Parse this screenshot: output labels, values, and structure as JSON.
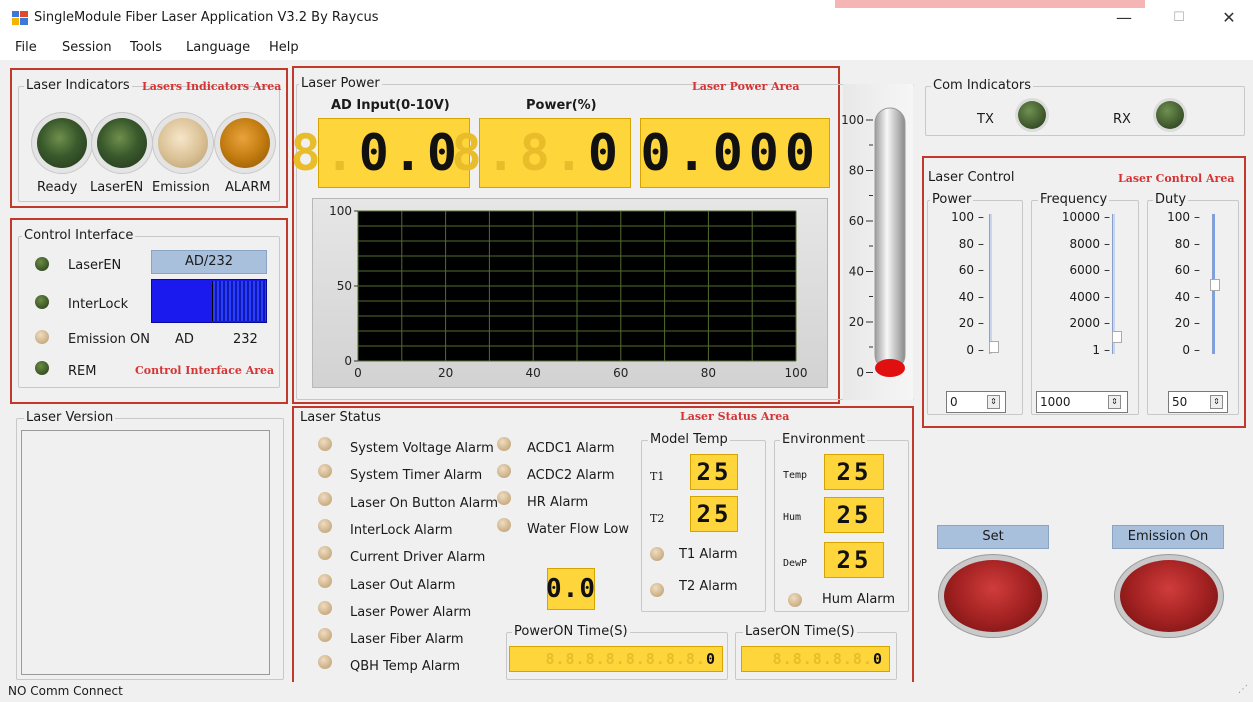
{
  "window": {
    "title": "SingleModule Fiber Laser Application V3.2  By Raycus",
    "minimize": "—",
    "maximize": "☐",
    "close": "✕"
  },
  "menu": [
    "File",
    "Session",
    "Tools",
    "Language",
    "Help"
  ],
  "laser_indicators": {
    "group_label": "Laser Indicators",
    "area_label": "Lasers Indicators Area",
    "leds": [
      {
        "label": "Ready",
        "color": "#3a5a2c"
      },
      {
        "label": "LaserEN",
        "color": "#3a5a2c"
      },
      {
        "label": "Emission",
        "color": "#dcc398"
      },
      {
        "label": "ALARM",
        "color": "#c27c10"
      }
    ]
  },
  "control_interface": {
    "group_label": "Control Interface",
    "area_label": "Control Interface Area",
    "items": [
      "LaserEN",
      "InterLock",
      "Emission ON",
      "REM"
    ],
    "mode_button": "AD/232",
    "switch_left": "AD",
    "switch_right": "232"
  },
  "laser_version": {
    "group_label": "Laser Version"
  },
  "laser_power": {
    "group_label": "Laser Power",
    "area_label": "Laser Power Area",
    "ad_label": "AD Input(0-10V)",
    "power_label": "Power(%)",
    "ad_ghost": "8.",
    "ad_value": "0.0",
    "power_ghost": "8.8.",
    "power_value": "0",
    "third_value": "0.000",
    "graph_y_ticks": [
      "100",
      "50",
      "0"
    ],
    "graph_x_ticks": [
      "0",
      "20",
      "40",
      "60",
      "80",
      "100"
    ],
    "thermo_ticks": [
      "100",
      "80",
      "60",
      "40",
      "20",
      "0"
    ]
  },
  "com_indicators": {
    "group_label": "Com Indicators",
    "tx": "TX",
    "rx": "RX"
  },
  "laser_control": {
    "group_label": "Laser Control",
    "area_label": "Laser Control Area",
    "power": {
      "label": "Power",
      "ticks": [
        "100",
        "80",
        "60",
        "40",
        "20",
        "0"
      ],
      "value": "0"
    },
    "frequency": {
      "label": "Frequency",
      "ticks": [
        "10000",
        "8000",
        "6000",
        "4000",
        "2000",
        "1"
      ],
      "value": "1000"
    },
    "duty": {
      "label": "Duty",
      "ticks": [
        "100",
        "80",
        "60",
        "40",
        "20",
        "0"
      ],
      "value": "50"
    }
  },
  "laser_status": {
    "group_label": "Laser Status",
    "area_label": "Laser Status Area",
    "alarms_left": [
      "System Voltage Alarm",
      "System Timer Alarm",
      "Laser On Button Alarm",
      "InterLock Alarm",
      "Current Driver Alarm",
      "Laser Out Alarm",
      "Laser Power Alarm",
      "Laser Fiber Alarm",
      "QBH Temp Alarm"
    ],
    "alarms_mid": [
      "ACDC1 Alarm",
      "ACDC2 Alarm",
      "HR Alarm",
      "Water Flow Low"
    ],
    "center_value": "0.0",
    "model_temp": {
      "label": "Model Temp",
      "t1_label": "T1",
      "t1_value": "25",
      "t2_label": "T2",
      "t2_value": "25",
      "t1_alarm": "T1 Alarm",
      "t2_alarm": "T2 Alarm"
    },
    "environment": {
      "label": "Environment",
      "temp_label": "Temp",
      "temp_value": "25",
      "hum_label": "Hum",
      "hum_value": "25",
      "dewp_label": "DewP",
      "dewp_value": "25",
      "hum_alarm": "Hum Alarm"
    },
    "poweron_label": "PowerON Time(S)",
    "poweron_ghost": "8.8.8.8.8.8.8.8.",
    "poweron_value": "0",
    "laseron_label": "LaserON Time(S)",
    "laseron_ghost": "8.8.8.8.8.",
    "laseron_value": "0"
  },
  "buttons": {
    "set": "Set",
    "emission_on": "Emission On"
  },
  "status_bar": "NO Comm Connect"
}
